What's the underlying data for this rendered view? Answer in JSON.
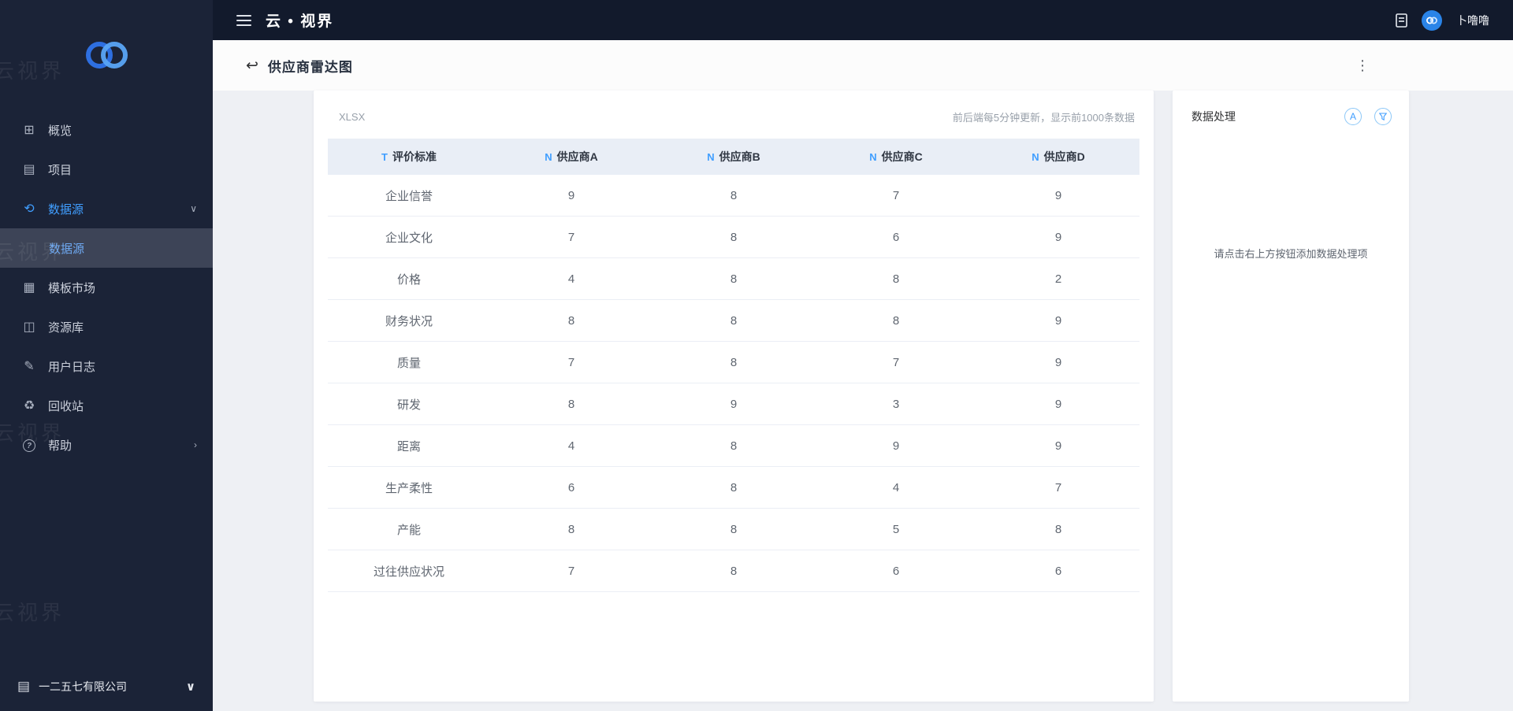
{
  "topbar": {
    "title": "云 • 视界",
    "username": "卜噜噜"
  },
  "sidebar": {
    "watermark": "云视界",
    "items": [
      {
        "label": "概览"
      },
      {
        "label": "项目"
      },
      {
        "label": "数据源"
      },
      {
        "label": "数据源"
      },
      {
        "label": "模板市场"
      },
      {
        "label": "资源库"
      },
      {
        "label": "用户日志"
      },
      {
        "label": "回收站"
      },
      {
        "label": "帮助"
      }
    ],
    "company": "一二五七有限公司"
  },
  "page": {
    "title": "供应商雷达图"
  },
  "datasheet": {
    "source_type": "XLSX",
    "update_note": "前后端每5分钟更新，显示前1000条数据",
    "table": {
      "columns": [
        {
          "type": "T",
          "label": "评价标准"
        },
        {
          "type": "N",
          "label": "供应商A"
        },
        {
          "type": "N",
          "label": "供应商B"
        },
        {
          "type": "N",
          "label": "供应商C"
        },
        {
          "type": "N",
          "label": "供应商D"
        }
      ],
      "rows": [
        [
          "企业信誉",
          9,
          8,
          7,
          9
        ],
        [
          "企业文化",
          7,
          8,
          6,
          9
        ],
        [
          "价格",
          4,
          8,
          8,
          2
        ],
        [
          "财务状况",
          8,
          8,
          8,
          9
        ],
        [
          "质量",
          7,
          8,
          7,
          9
        ],
        [
          "研发",
          8,
          9,
          3,
          9
        ],
        [
          "距离",
          4,
          8,
          9,
          9
        ],
        [
          "生产柔性",
          6,
          8,
          4,
          7
        ],
        [
          "产能",
          8,
          8,
          5,
          8
        ],
        [
          "过往供应状况",
          7,
          8,
          6,
          6
        ]
      ]
    }
  },
  "processing_panel": {
    "title": "数据处理",
    "empty_hint": "请点击右上方按钮添加数据处理项",
    "aggregate_glyph": "A"
  },
  "icons": {
    "overview": "⊞",
    "projects": "▤",
    "datasource": "⟲",
    "template_market": "▦",
    "resource_library": "◫",
    "user_log": "✎",
    "recycle": "♻",
    "help": "?",
    "company": "▤",
    "chevron_down": "∨",
    "chevron_right": "›",
    "back": "↩",
    "kebab": "⋮"
  },
  "colors": {
    "accent": "#409eff",
    "sidebar_bg": "#1b2337",
    "topbar_bg": "#121a2c",
    "table_header_bg": "#e9eef6",
    "content_bg": "#eef0f4"
  }
}
